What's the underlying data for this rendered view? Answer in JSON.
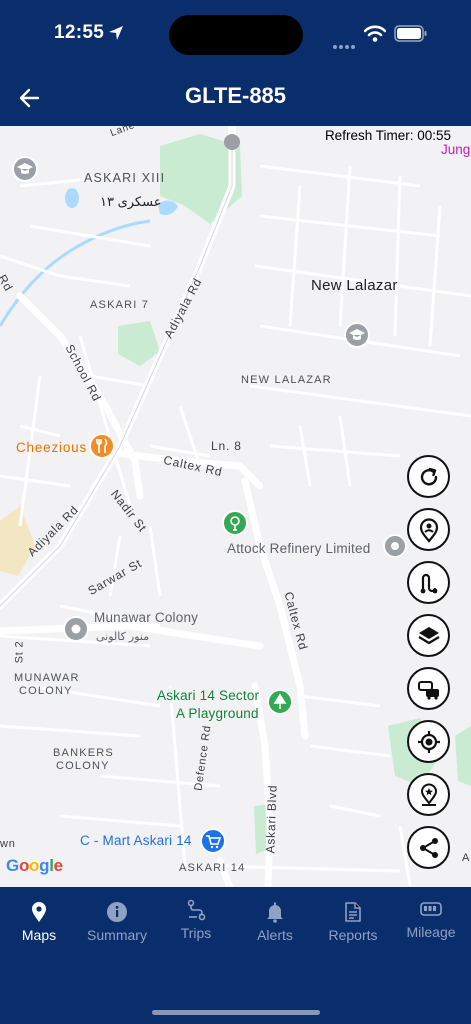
{
  "status": {
    "time": "12:55"
  },
  "header": {
    "title": "GLTE-885"
  },
  "map": {
    "refresh_timer": "Refresh Timer: 00:55",
    "labels": {
      "jung": "Jung",
      "lane": "Lane",
      "askari13": "ASKARI XIII",
      "askari13_urdu": "عسکری ۱۳",
      "askari7": "ASKARI 7",
      "adiyala_rd_top": "Adiyala Rd",
      "new_lalazar_big": "New Lalazar",
      "new_lalazar_area": "NEW LALAZAR",
      "school_rd": "School Rd",
      "cheezious": "Cheezious",
      "ln8": "Ln. 8",
      "caltex_rd": "Caltex Rd",
      "nadir_st": "Nadir St",
      "attock_refinery": "Attock Refinery Limited",
      "adiyala_rd_bottom": "Adiyala Rd",
      "sarwar_st": "Sarwar St",
      "munawar_colony": "Munawar Colony",
      "munawar_colony_urdu": "منور کالونی",
      "munawar_colony_area_1": "MUNAWAR",
      "munawar_colony_area_2": "COLONY",
      "caltex_rd_vertical": "Caltex Rd",
      "st2": "St 2",
      "askari14_playground_1": "Askari 14 Sector",
      "askari14_playground_2": "A Playground",
      "bankers_colony_1": "BANKERS",
      "bankers_colony_2": "COLONY",
      "defence_rd": "Defence Rd",
      "askari_blvd": "Askari Blvd",
      "cmart": "C - Mart Askari 14",
      "askari14_area": "ASKARI 14",
      "rd_left": "Rd",
      "wn": "wn",
      "a_edge": "A"
    },
    "google_logo": [
      "G",
      "o",
      "o",
      "g",
      "l",
      "e"
    ],
    "controls": [
      {
        "name": "refresh-icon"
      },
      {
        "name": "driver-location-icon"
      },
      {
        "name": "route-icon"
      },
      {
        "name": "layers-icon"
      },
      {
        "name": "traffic-icon"
      },
      {
        "name": "my-location-icon"
      },
      {
        "name": "favorite-place-icon"
      },
      {
        "name": "share-icon"
      }
    ]
  },
  "nav": {
    "items": [
      {
        "label": "Maps",
        "icon": "map-pin-icon",
        "active": true
      },
      {
        "label": "Summary",
        "icon": "info-icon",
        "active": false
      },
      {
        "label": "Trips",
        "icon": "trips-icon",
        "active": false
      },
      {
        "label": "Alerts",
        "icon": "bell-icon",
        "active": false
      },
      {
        "label": "Reports",
        "icon": "document-icon",
        "active": false
      },
      {
        "label": "Mileage",
        "icon": "odometer-icon",
        "active": false
      }
    ]
  },
  "colors": {
    "primary": "#0a2d6b",
    "nav_inactive": "#8fa1c4",
    "map_bg": "#f2f1f4",
    "park": "#c8ebd2",
    "poi_blue": "#1a73e8",
    "poi_green": "#188038",
    "poi_orange": "#e37400"
  }
}
